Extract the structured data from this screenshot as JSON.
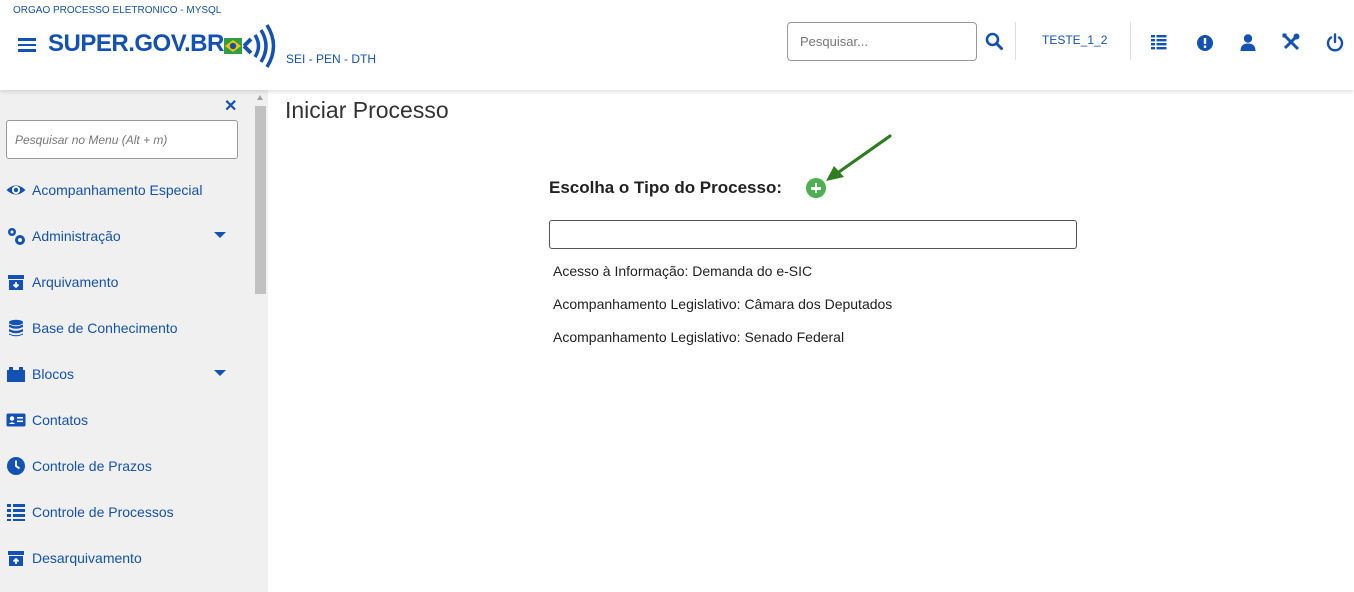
{
  "header": {
    "org_name": "ORGAO PROCESSO ELETRONICO - MYSQL",
    "logo_text": "SUPER.GOV.BR",
    "subtitle": "SEI - PEN - DTH",
    "search_placeholder": "Pesquisar...",
    "user": "TESTE_1_2",
    "icons": [
      "search-icon",
      "grid-icon",
      "alert-icon",
      "user-icon",
      "tools-icon",
      "power-icon"
    ]
  },
  "sidebar": {
    "search_placeholder": "Pesquisar no Menu (Alt + m)",
    "items": [
      {
        "label": "Acompanhamento Especial",
        "icon": "eye-icon"
      },
      {
        "label": "Administração",
        "icon": "gears-icon",
        "has_submenu": true
      },
      {
        "label": "Arquivamento",
        "icon": "archive-icon"
      },
      {
        "label": "Base de Conhecimento",
        "icon": "database-icon"
      },
      {
        "label": "Blocos",
        "icon": "blocks-icon",
        "has_submenu": true
      },
      {
        "label": "Contatos",
        "icon": "contact-card-icon"
      },
      {
        "label": "Controle de Prazos",
        "icon": "clock-icon"
      },
      {
        "label": "Controle de Processos",
        "icon": "list-icon"
      },
      {
        "label": "Desarquivamento",
        "icon": "unarchive-icon"
      }
    ]
  },
  "main": {
    "title": "Iniciar Processo",
    "choose_label": "Escolha o Tipo do Processo:",
    "type_input_value": "",
    "options": [
      "Acesso à Informação: Demanda do e-SIC",
      "Acompanhamento Legislativo: Câmara dos Deputados",
      "Acompanhamento Legislativo: Senado Federal"
    ]
  },
  "colors": {
    "primary": "#1351b4",
    "plus_button": "#4caf50",
    "arrow": "#2e7d1f",
    "sidebar_bg": "#f0f0f0"
  }
}
